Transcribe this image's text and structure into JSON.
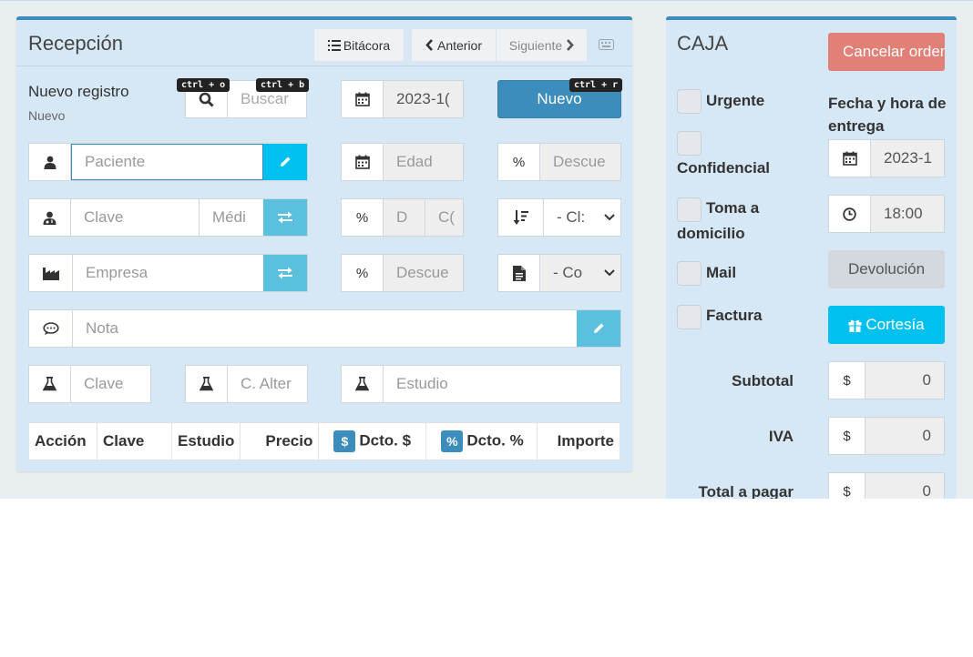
{
  "reception": {
    "title": "Recepción",
    "bitacora_label": "Bitácora",
    "prev_label": "Anterior",
    "next_label": "Siguiente",
    "new_record_title": "Nuevo registro",
    "new_record_sub": "Nuevo",
    "shortcut_search": "ctrl + o",
    "shortcut_buscar": "ctrl + b",
    "shortcut_new": "ctrl + r",
    "search_placeholder": "Buscar",
    "date_value": "2023-1(",
    "new_button": "Nuevo",
    "patient_placeholder": "Paciente",
    "age_placeholder": "Edad",
    "discount_placeholder": "Descue",
    "percent_symbol": "%",
    "doctor_key_placeholder": "Clave",
    "doctor_name_placeholder": "Médi",
    "d_placeholder": "D",
    "c_placeholder": "C(",
    "class_select": "- Cl:",
    "company_placeholder": "Empresa",
    "company_discount_placeholder": "Descue",
    "concept_select": "- Co",
    "note_placeholder": "Nota",
    "study_key_placeholder": "Clave",
    "alt_key_placeholder": "C. Alter",
    "study_placeholder": "Estudio",
    "table_headers": {
      "accion": "Acción",
      "clave": "Clave",
      "estudio": "Estudio",
      "precio": "Precio",
      "dcto_money": "Dcto. $",
      "dcto_pct": "Dcto. %",
      "importe": "Importe",
      "badge_money": "$",
      "badge_pct": "%"
    }
  },
  "caja": {
    "title": "CAJA",
    "cancel_label": "Cancelar orden",
    "urgent_label": "Urgente",
    "confidential_label": "Confidencial",
    "home_label_1": "Toma a",
    "home_label_2": "domicilio",
    "mail_label": "Mail",
    "invoice_label": "Factura",
    "delivery_label": "Fecha y hora de entrega",
    "delivery_date": "2023-1",
    "delivery_time": "18:00",
    "devolucion_label": "Devolución",
    "cortesia_label": "Cortesía",
    "subtotal_label": "Subtotal",
    "iva_label": "IVA",
    "total_label": "Total a pagar",
    "currency": "$",
    "subtotal_value": "0",
    "iva_value": "0",
    "total_value": "0"
  },
  "colors": {
    "primary": "#3c8dbc",
    "info": "#00c0ef",
    "danger": "#dd4b39"
  }
}
